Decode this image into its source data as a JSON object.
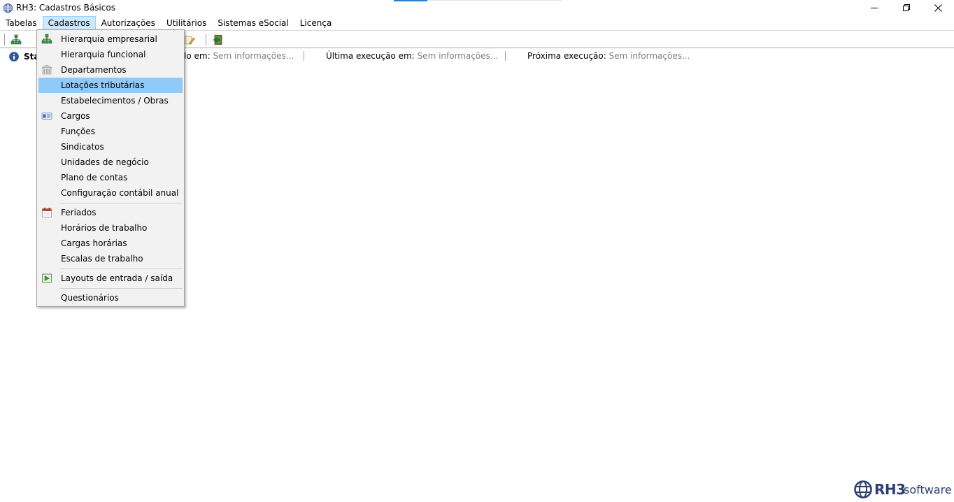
{
  "window": {
    "title": "RH3: Cadastros Básicos"
  },
  "menubar": {
    "items": [
      {
        "label": "Tabelas"
      },
      {
        "label": "Cadastros",
        "active": true
      },
      {
        "label": "Autorizações"
      },
      {
        "label": "Utilitários"
      },
      {
        "label": "Sistemas eSocial"
      },
      {
        "label": "Licença"
      }
    ]
  },
  "status": {
    "label_partial": "Sta",
    "field1_label": "lo em:",
    "field1_value": "Sem informações...",
    "field2_label": "Última execução em:",
    "field2_value": "Sem informações...",
    "field3_label": "Próxima execução:",
    "field3_value": "Sem informações..."
  },
  "dropdown": {
    "items": [
      {
        "label": "Hierarquia empresarial",
        "icon": "org-chart-icon"
      },
      {
        "label": "Hierarquia funcional"
      },
      {
        "label": "Departamentos",
        "icon": "building-icon"
      },
      {
        "label": "Lotações tributárias",
        "highlighted": true
      },
      {
        "label": "Estabelecimentos / Obras"
      },
      {
        "label": "Cargos",
        "icon": "id-card-icon"
      },
      {
        "label": "Funções"
      },
      {
        "label": "Sindicatos"
      },
      {
        "label": "Unidades de negócio"
      },
      {
        "label": "Plano de contas"
      },
      {
        "label": "Configuração contábil anual"
      },
      {
        "label": "Feriados",
        "icon": "calendar-icon"
      },
      {
        "label": "Horários de trabalho"
      },
      {
        "label": "Cargas horárias"
      },
      {
        "label": "Escalas de trabalho"
      },
      {
        "label": "Layouts de entrada / saída",
        "icon": "layout-arrow-icon"
      },
      {
        "label": "Questionários"
      }
    ]
  },
  "logo": {
    "brand": "RH3",
    "suffix": "software"
  },
  "colors": {
    "menu_active_bg": "#cce8ff",
    "menu_highlight_bg": "#91c9f7",
    "logo_blue": "#2b3f73",
    "accent_blue": "#2a7fd4"
  }
}
